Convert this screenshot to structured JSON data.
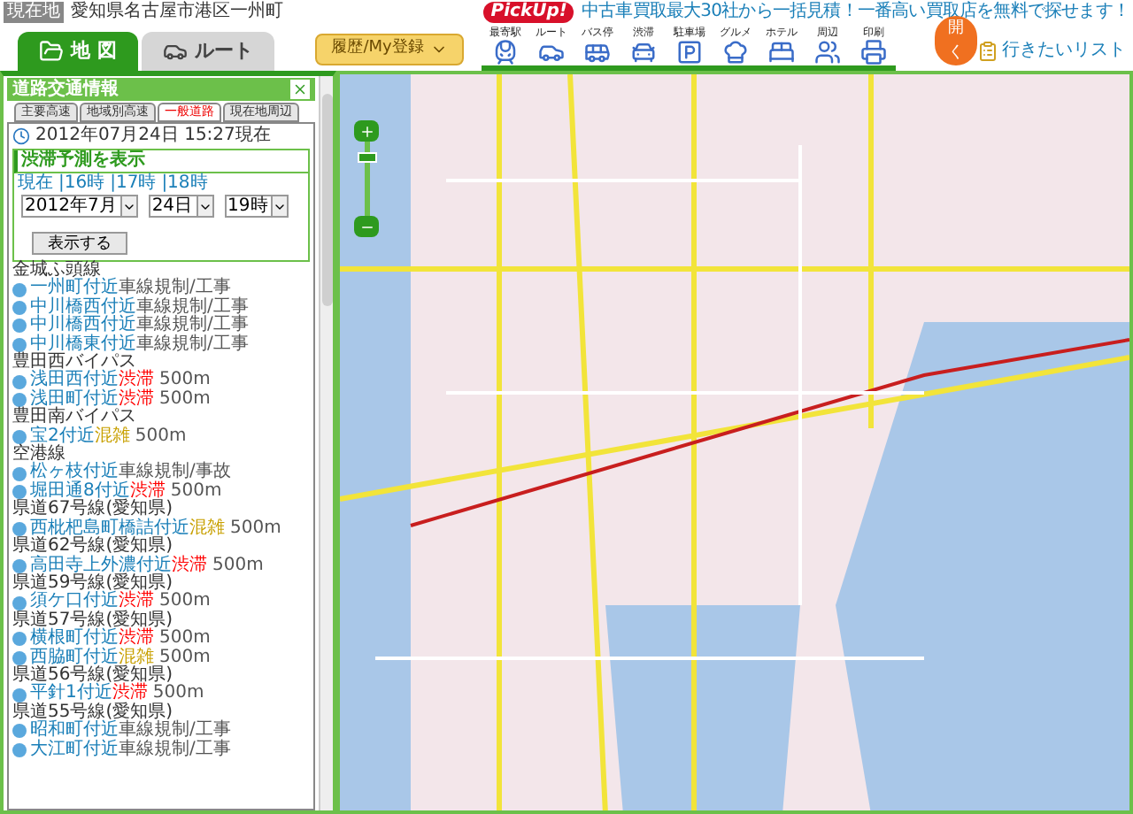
{
  "location": {
    "badge": "現在地",
    "address": "愛知県名古屋市港区一州町"
  },
  "ad": {
    "badge": "PickUp!",
    "text": "中古車買取最大30社から一括見積！一番高い買取店を無料で探せます！"
  },
  "main_tabs": [
    {
      "label": "地 図",
      "selected": true
    },
    {
      "label": "ルート",
      "selected": false
    }
  ],
  "history_dropdown": "履歴/My登録",
  "toolbar": [
    "最寄駅",
    "ルート",
    "バス停",
    "渋滞",
    "駐車場",
    "グルメ",
    "ホテル",
    "周辺",
    "印刷"
  ],
  "open_button": "開く",
  "wish_list": "行きたいリスト",
  "panel": {
    "title": "道路交通情報",
    "tabs": [
      {
        "label": "主要高速",
        "selected": false
      },
      {
        "label": "地域別高速",
        "selected": false
      },
      {
        "label": "一般道路",
        "selected": true
      },
      {
        "label": "現在地周辺",
        "selected": false
      }
    ],
    "timestamp": "2012年07月24日 15:27現在",
    "forecast": {
      "title": "渋滞予測を表示",
      "links": [
        "現在",
        "|16時",
        "|17時",
        "|18時"
      ],
      "selects": [
        "2012年7月",
        "24日",
        "19時"
      ],
      "button": "表示する"
    },
    "roads": [
      {
        "name": "金城ふ頭線",
        "items": [
          {
            "place": "一州町付近",
            "status": "車線規制/工事",
            "color": "#555555"
          },
          {
            "place": "中川橋西付近",
            "status": "車線規制/工事",
            "color": "#555555"
          },
          {
            "place": "中川橋西付近",
            "status": "車線規制/工事",
            "color": "#555555"
          },
          {
            "place": "中川橋東付近",
            "status": "車線規制/工事",
            "color": "#555555"
          }
        ]
      },
      {
        "name": "豊田西バイパス",
        "items": [
          {
            "place": "浅田西付近",
            "status": "渋滞",
            "color": "#ff0000",
            "distance": "500m"
          },
          {
            "place": "浅田町付近",
            "status": "渋滞",
            "color": "#ff0000",
            "distance": "500m"
          }
        ]
      },
      {
        "name": "豊田南バイパス",
        "items": [
          {
            "place": "宝2付近",
            "status": "混雑",
            "color": "#c8a000",
            "distance": "500m"
          }
        ]
      },
      {
        "name": "空港線",
        "items": [
          {
            "place": "松ヶ枝付近",
            "status": "車線規制/事故",
            "color": "#555555"
          },
          {
            "place": "堀田通8付近",
            "status": "渋滞",
            "color": "#ff0000",
            "distance": "500m"
          }
        ]
      },
      {
        "name": "県道67号線(愛知県)",
        "items": [
          {
            "place": "西枇杷島町橋詰付近",
            "status": "混雑",
            "color": "#c8a000",
            "distance": "500m"
          }
        ]
      },
      {
        "name": "県道62号線(愛知県)",
        "items": [
          {
            "place": "高田寺上外濃付近",
            "status": "渋滞",
            "color": "#ff0000",
            "distance": "500m"
          }
        ]
      },
      {
        "name": "県道59号線(愛知県)",
        "items": [
          {
            "place": "須ケ口付近",
            "status": "渋滞",
            "color": "#ff0000",
            "distance": "500m"
          }
        ]
      },
      {
        "name": "県道57号線(愛知県)",
        "items": [
          {
            "place": "横根町付近",
            "status": "渋滞",
            "color": "#ff0000",
            "distance": "500m"
          },
          {
            "place": "西脇町付近",
            "status": "混雑",
            "color": "#c8a000",
            "distance": "500m"
          }
        ]
      },
      {
        "name": "県道56号線(愛知県)",
        "items": [
          {
            "place": "平針1付近",
            "status": "渋滞",
            "color": "#ff0000",
            "distance": "500m"
          }
        ]
      },
      {
        "name": "県道55号線(愛知県)",
        "items": [
          {
            "place": "昭和町付近",
            "status": "車線規制/工事",
            "color": "#555555"
          },
          {
            "place": "大江町付近",
            "status": "車線規制/工事",
            "color": "#555555"
          }
        ]
      }
    ]
  },
  "zoom": {
    "level": 0.85
  }
}
